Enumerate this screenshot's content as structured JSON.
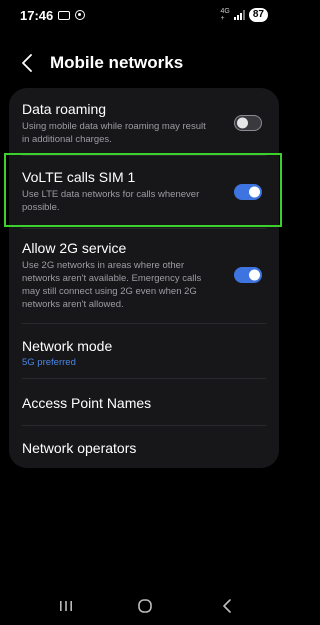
{
  "status_bar": {
    "time": "17:46",
    "network_type_top": "4G",
    "network_type_bottom": "+",
    "battery": "87"
  },
  "header": {
    "title": "Mobile networks"
  },
  "settings": {
    "data_roaming": {
      "title": "Data roaming",
      "description": "Using mobile data while roaming may result in additional charges.",
      "enabled": false
    },
    "volte_calls": {
      "title": "VoLTE calls SIM 1",
      "description": "Use LTE data networks for calls whenever possible.",
      "enabled": true
    },
    "allow_2g": {
      "title": "Allow 2G service",
      "description": "Use 2G networks in areas where other networks aren't available. Emergency calls may still connect using 2G even when 2G networks aren't allowed.",
      "enabled": true
    },
    "network_mode": {
      "title": "Network mode",
      "value": "5G preferred"
    },
    "access_point_names": {
      "title": "Access Point Names"
    },
    "network_operators": {
      "title": "Network operators"
    }
  },
  "icons": {
    "back": "back-chevron-icon",
    "recent_apps": "recent-apps-icon",
    "home": "home-icon",
    "nav_back": "nav-back-icon"
  },
  "colors": {
    "accent": "#3e74e0",
    "highlight": "#39d12a",
    "card": "#17171a",
    "subtext": "#9d9da2",
    "link": "#4a86e8"
  }
}
